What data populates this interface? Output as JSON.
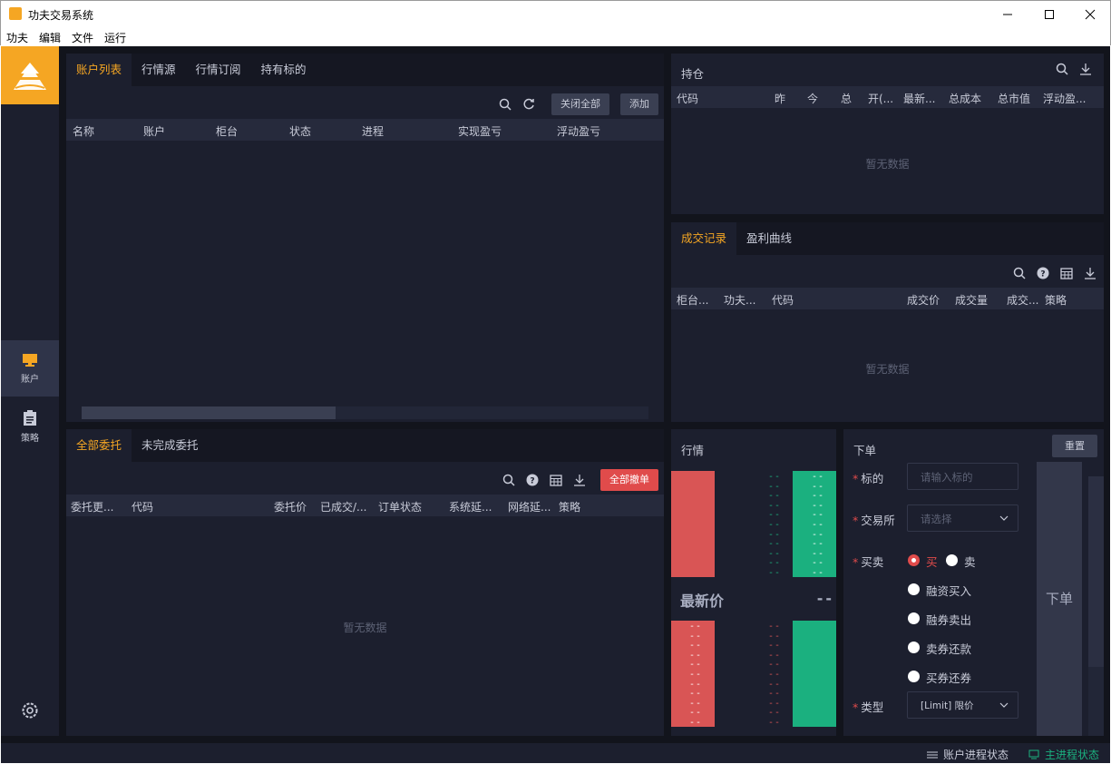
{
  "window": {
    "title": "功夫交易系统"
  },
  "menu": [
    "功夫",
    "编辑",
    "文件",
    "运行"
  ],
  "sidebar": {
    "items": [
      {
        "label": "账户"
      },
      {
        "label": "策略"
      }
    ]
  },
  "accounts": {
    "tabs": [
      "账户列表",
      "行情源",
      "行情订阅",
      "持有标的"
    ],
    "close_all": "关闭全部",
    "add": "添加",
    "columns": [
      "名称",
      "账户",
      "柜台",
      "状态",
      "进程",
      "实现盈亏",
      "浮动盈亏"
    ]
  },
  "positions": {
    "title": "持仓",
    "columns": [
      "代码",
      "昨",
      "今",
      "总",
      "开(...",
      "最新...",
      "总成本",
      "总市值",
      "浮动盈..."
    ],
    "empty": "暂无数据"
  },
  "trades": {
    "tabs": [
      "成交记录",
      "盈利曲线"
    ],
    "columns": [
      "柜台...",
      "功夫...",
      "代码",
      "成交价",
      "成交量",
      "成交...",
      "策略"
    ],
    "empty": "暂无数据"
  },
  "orders": {
    "tabs": [
      "全部委托",
      "未完成委托"
    ],
    "cancel_all": "全部撤单",
    "columns": [
      "委托更...",
      "代码",
      "委托价",
      "已成交/...",
      "订单状态",
      "系统延...",
      "网络延...",
      "策略"
    ],
    "empty": "暂无数据"
  },
  "market": {
    "title": "行情",
    "last_price_label": "最新价",
    "last_price_value": "--",
    "placeholder": "--"
  },
  "order_form": {
    "title": "下单",
    "reset": "重置",
    "symbol_label": "标的",
    "symbol_placeholder": "请输入标的",
    "exchange_label": "交易所",
    "exchange_placeholder": "请选择",
    "side_label": "买卖",
    "buy": "买",
    "sell": "卖",
    "options": [
      "融资买入",
      "融券卖出",
      "卖券还款",
      "买券还券"
    ],
    "type_label": "类型",
    "type_value": "[Limit] 限价",
    "submit": "下单"
  },
  "status": {
    "account_process": "账户进程状态",
    "main_process": "主进程状态"
  },
  "colors": {
    "accent": "#f5a623",
    "up": "#d95555",
    "down": "#1bb07f",
    "bg": "#1c1f2e"
  }
}
